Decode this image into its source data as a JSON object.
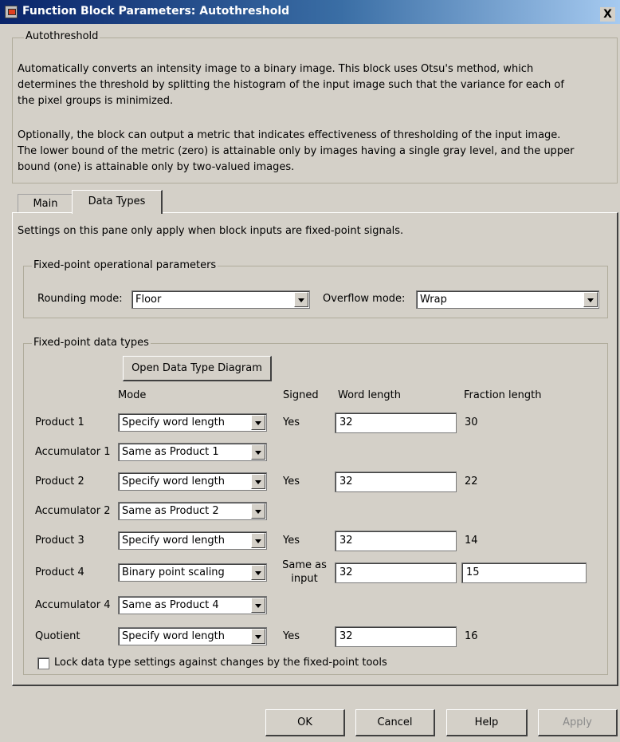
{
  "window": {
    "title": "Function Block Parameters: Autothreshold",
    "close_label": "X"
  },
  "description": {
    "group_title": "Autothreshold",
    "paragraph1_lines": [
      "Automatically converts an intensity image to a binary image.  This block uses Otsu's method, which",
      "determines the threshold by splitting the histogram of the input image such that the variance for each of",
      "the pixel groups is minimized."
    ],
    "paragraph2_lines": [
      "Optionally, the block can output a metric that indicates effectiveness of thresholding of the input image.",
      "The lower bound of the metric (zero) is attainable only by images having a single gray level, and the upper",
      "bound (one) is attainable only by two-valued images."
    ]
  },
  "tabs": [
    {
      "label": "Main",
      "active": false
    },
    {
      "label": "Data Types",
      "active": true
    }
  ],
  "panel": {
    "note": "Settings on this pane only apply when block inputs are fixed-point signals.",
    "op_params": {
      "group_title": "Fixed-point operational parameters",
      "rounding_label": "Rounding mode:",
      "rounding_value": "Floor",
      "overflow_label": "Overflow mode:",
      "overflow_value": "Wrap"
    },
    "data_types": {
      "group_title": "Fixed-point data types",
      "open_diagram_button": "Open Data Type Diagram",
      "headers": {
        "mode": "Mode",
        "signed": "Signed",
        "word_length": "Word length",
        "fraction_length": "Fraction length"
      },
      "rows": [
        {
          "label": "Product 1",
          "mode": "Specify word length",
          "signed": "Yes",
          "word_length": "32",
          "fraction_length": "30"
        },
        {
          "label": "Accumulator 1",
          "mode": "Same as Product 1"
        },
        {
          "label": "Product 2",
          "mode": "Specify word length",
          "signed": "Yes",
          "word_length": "32",
          "fraction_length": "22"
        },
        {
          "label": "Accumulator 2",
          "mode": "Same as Product 2"
        },
        {
          "label": "Product 3",
          "mode": "Specify word length",
          "signed": "Yes",
          "word_length": "32",
          "fraction_length": "14"
        },
        {
          "label": "Product 4",
          "mode": "Binary point scaling",
          "signed_line1": "Same as",
          "signed_line2": "input",
          "word_length": "32",
          "fraction_length": "15"
        },
        {
          "label": "Accumulator 4",
          "mode": "Same as Product 4"
        },
        {
          "label": "Quotient",
          "mode": "Specify word length",
          "signed": "Yes",
          "word_length": "32",
          "fraction_length": "16"
        }
      ],
      "lock_checkbox_label": "Lock data type settings against changes by the fixed-point tools",
      "lock_checked": false
    }
  },
  "buttons": {
    "ok": "OK",
    "cancel": "Cancel",
    "help": "Help",
    "apply": "Apply"
  }
}
